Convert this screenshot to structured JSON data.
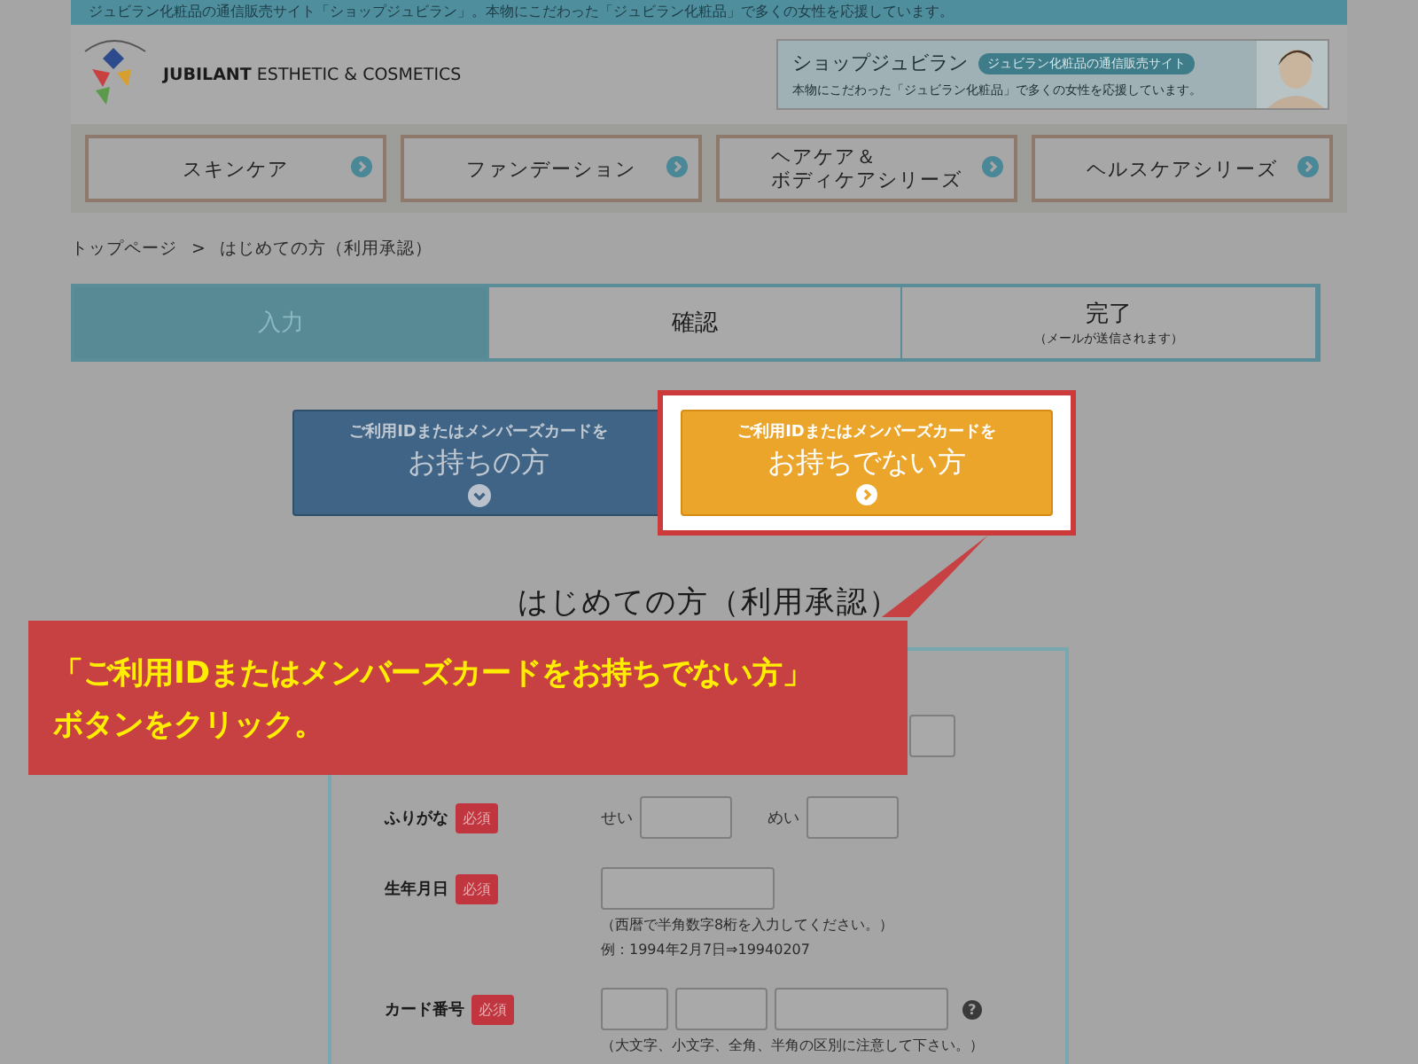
{
  "top_bar": {
    "text": "ジュビラン化粧品の通信販売サイト「ショップジュビラン」。本物にこだわった「ジュビラン化粧品」で多くの女性を応援しています。"
  },
  "header": {
    "brand_bold": "JUBILANT",
    "brand_rest": "ESTHETIC & COSMETICS",
    "banner": {
      "title": "ショップジュビラン",
      "badge": "ジュビラン化粧品の通信販売サイト",
      "tagline": "本物にこだわった「ジュビラン化粧品」で多くの女性を応援しています。"
    }
  },
  "nav": [
    {
      "lines": [
        "スキンケア"
      ]
    },
    {
      "lines": [
        "ファンデーション"
      ]
    },
    {
      "lines": [
        "ヘアケア＆",
        "ボディケアシリーズ"
      ]
    },
    {
      "lines": [
        "ヘルスケアシリーズ"
      ]
    }
  ],
  "breadcrumb": {
    "separator": ">",
    "items": [
      "トップページ",
      "はじめての方（利用承認）"
    ]
  },
  "steps": [
    {
      "label": "入力",
      "selected": true
    },
    {
      "label": "確認",
      "selected": false
    },
    {
      "label": "完了",
      "note": "（メールが送信されます）",
      "selected": false
    }
  ],
  "member_buttons": [
    {
      "kind": "member",
      "line1": "ご利用IDまたはメンバーズカードを",
      "line2": "お持ちの方",
      "highlighted": false
    },
    {
      "kind": "guest",
      "line1": "ご利用IDまたはメンバーズカードを",
      "line2": "お持ちでない方",
      "highlighted": true
    }
  ],
  "page_title": "はじめての方（利用承認）",
  "form": {
    "rows": [
      {
        "label": "ふりがな",
        "required": "必須",
        "fields": [
          {
            "kind": "medium",
            "prefix": "せい"
          },
          {
            "kind": "medium",
            "prefix": "めい"
          }
        ]
      },
      {
        "label": "生年月日",
        "required": "必須",
        "fields": [
          {
            "kind": "long"
          }
        ],
        "hints": [
          "（西暦で半角数字8桁を入力してください。）",
          "例：1994年2月7日⇒19940207"
        ]
      },
      {
        "label": "カード番号",
        "required": "必須",
        "fields": [
          {
            "kind": "short"
          },
          {
            "kind": "medium"
          },
          {
            "kind": "long"
          }
        ],
        "help": "?",
        "hints": [
          "（大文字、小文字、全角、半角の区別に注意して下さい。）"
        ]
      }
    ]
  },
  "callout": {
    "lines": [
      "「ご利用IDまたはメンバーズカードをお持ちでない方」",
      "ボタンをクリック。"
    ]
  }
}
